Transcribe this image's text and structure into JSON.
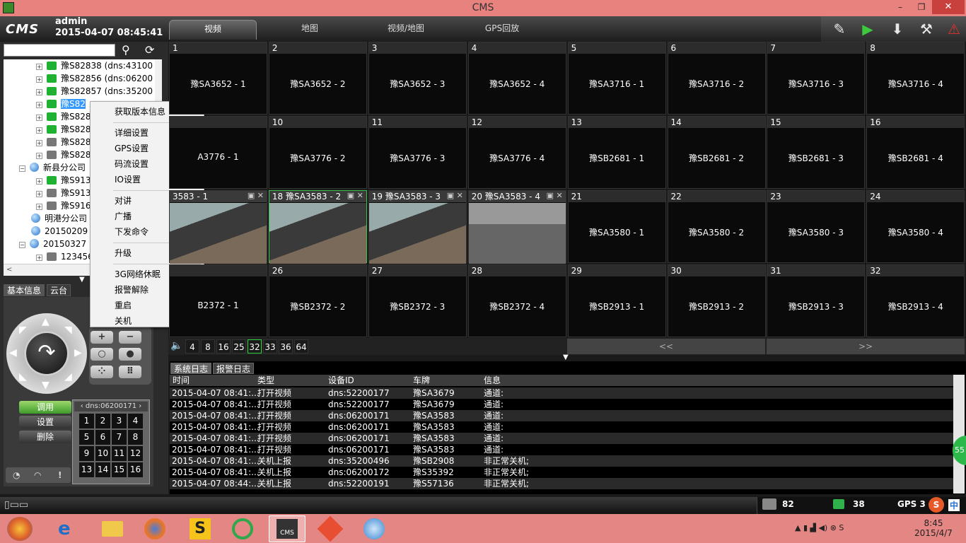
{
  "window": {
    "title": "CMS",
    "btn_min": "–",
    "btn_max": "❐",
    "btn_close": "✕"
  },
  "header": {
    "logo": "CMS",
    "user": "admin",
    "datetime": "2015-04-07 08:45:41",
    "tabs": [
      "视频",
      "地图",
      "视频/地图",
      "GPS回放"
    ]
  },
  "toolbar": {
    "icons": [
      "edit-icon",
      "play-record-icon",
      "download-icon",
      "wrench-icon",
      "alarm-icon"
    ]
  },
  "search": {
    "value": ""
  },
  "tree": [
    {
      "text": "豫S82838 (dns:43100",
      "icon": "g"
    },
    {
      "text": "豫S82856 (dns:06200",
      "icon": "g"
    },
    {
      "text": "豫S82857 (dns:35200",
      "icon": "g"
    },
    {
      "text": "豫S82",
      "icon": "g",
      "selected": true
    },
    {
      "text": "豫S828",
      "icon": "g"
    },
    {
      "text": "豫S828",
      "icon": "g"
    },
    {
      "text": "豫S828",
      "icon": "gr"
    },
    {
      "text": "豫S828",
      "icon": "gr"
    },
    {
      "text": "新县分公司",
      "icon": "gl",
      "root": true
    },
    {
      "text": "豫S913",
      "icon": "g"
    },
    {
      "text": "豫S913",
      "icon": "gr"
    },
    {
      "text": "豫S916",
      "icon": "gr"
    },
    {
      "text": "明港分公司",
      "icon": "gl",
      "root": true,
      "noexp": true
    },
    {
      "text": "20150209",
      "icon": "gl",
      "root": true,
      "noexp": true
    },
    {
      "text": "20150327",
      "icon": "gl",
      "root": true
    },
    {
      "text": "123456",
      "icon": "gr"
    }
  ],
  "left_tabs": [
    "基本信息",
    "云台"
  ],
  "ptz": {
    "call": "调用",
    "set": "设置",
    "del": "删除",
    "device": "dns:06200171",
    "presets": [
      "1",
      "2",
      "3",
      "4",
      "5",
      "6",
      "7",
      "8",
      "9",
      "10",
      "11",
      "12",
      "13",
      "14",
      "15",
      "16"
    ]
  },
  "menu": {
    "groups": [
      [
        "获取版本信息"
      ],
      [
        "详细设置",
        "GPS设置",
        "码流设置",
        "IO设置"
      ],
      [
        "对讲",
        "广播",
        "下发命令"
      ],
      [
        "升级"
      ],
      [
        "3G网络休眠",
        "报警解除",
        "重启",
        "关机"
      ]
    ]
  },
  "cells": [
    {
      "n": "1",
      "label": "豫SA3652 - 1"
    },
    {
      "n": "2",
      "label": "豫SA3652 - 2"
    },
    {
      "n": "3",
      "label": "豫SA3652 - 3"
    },
    {
      "n": "4",
      "label": "豫SA3652 - 4"
    },
    {
      "n": "5",
      "label": "豫SA3716 - 1"
    },
    {
      "n": "6",
      "label": "豫SA3716 - 2"
    },
    {
      "n": "7",
      "label": "豫SA3716 - 3"
    },
    {
      "n": "8",
      "label": "豫SA3716 - 4"
    },
    {
      "n": "",
      "label": "A3776 - 1"
    },
    {
      "n": "10",
      "label": "豫SA3776 - 2"
    },
    {
      "n": "11",
      "label": "豫SA3776 - 3"
    },
    {
      "n": "12",
      "label": "豫SA3776 - 4"
    },
    {
      "n": "13",
      "label": "豫SB2681 - 1"
    },
    {
      "n": "14",
      "label": "豫SB2681 - 2"
    },
    {
      "n": "15",
      "label": "豫SB2681 - 3"
    },
    {
      "n": "16",
      "label": "豫SB2681 - 4"
    },
    {
      "n": "3583 - 1",
      "label": "",
      "video": true
    },
    {
      "n": "18 豫SA3583 - 2",
      "label": "",
      "video": true,
      "sel": true
    },
    {
      "n": "19 豫SA3583 - 3",
      "label": "",
      "video": true
    },
    {
      "n": "20 豫SA3583 - 4",
      "label": "",
      "video": true
    },
    {
      "n": "21",
      "label": "豫SA3580 - 1"
    },
    {
      "n": "22",
      "label": "豫SA3580 - 2"
    },
    {
      "n": "23",
      "label": "豫SA3580 - 3"
    },
    {
      "n": "24",
      "label": "豫SA3580 - 4"
    },
    {
      "n": "",
      "label": "B2372 - 1"
    },
    {
      "n": "26",
      "label": "豫SB2372 - 2"
    },
    {
      "n": "27",
      "label": "豫SB2372 - 3"
    },
    {
      "n": "28",
      "label": "豫SB2372 - 4"
    },
    {
      "n": "29",
      "label": "豫SB2913 - 1"
    },
    {
      "n": "30",
      "label": "豫SB2913 - 2"
    },
    {
      "n": "31",
      "label": "豫SB2913 - 3"
    },
    {
      "n": "32",
      "label": "豫SB2913 - 4"
    }
  ],
  "gridbar": {
    "counts": [
      "4",
      "8",
      "16",
      "25",
      "32",
      "33",
      "36",
      "64"
    ],
    "active": "32",
    "prev": "<<",
    "next": ">>"
  },
  "log": {
    "tabs": [
      "系统日志",
      "报警日志"
    ],
    "columns": [
      "时间",
      "类型",
      "设备ID",
      "车牌",
      "信息"
    ],
    "rows": [
      [
        "2015-04-07 08:41:...",
        "打开视频",
        "dns:52200177",
        "豫SA3679",
        "通道:"
      ],
      [
        "2015-04-07 08:41:...",
        "打开视频",
        "dns:52200177",
        "豫SA3679",
        "通道:"
      ],
      [
        "2015-04-07 08:41:...",
        "打开视频",
        "dns:06200171",
        "豫SA3583",
        "通道:"
      ],
      [
        "2015-04-07 08:41:...",
        "打开视频",
        "dns:06200171",
        "豫SA3583",
        "通道:"
      ],
      [
        "2015-04-07 08:41:...",
        "打开视频",
        "dns:06200171",
        "豫SA3583",
        "通道:"
      ],
      [
        "2015-04-07 08:41:...",
        "打开视频",
        "dns:06200171",
        "豫SA3583",
        "通道:"
      ],
      [
        "2015-04-07 08:41:...",
        "关机上报",
        "dns:35200496",
        "豫SB2908",
        "非正常关机;"
      ],
      [
        "2015-04-07 08:41:...",
        "关机上报",
        "dns:06200172",
        "豫S35392",
        "非正常关机;"
      ],
      [
        "2015-04-07 08:44:...",
        "关机上报",
        "dns:52200191",
        "豫S57136",
        "非正常关机;"
      ]
    ]
  },
  "status": {
    "online": "82",
    "count2": "38",
    "gps": "GPS 3",
    "badge": "55",
    "ime": "中"
  },
  "taskbar": {
    "time": "8:45",
    "date": "2015/4/7"
  }
}
